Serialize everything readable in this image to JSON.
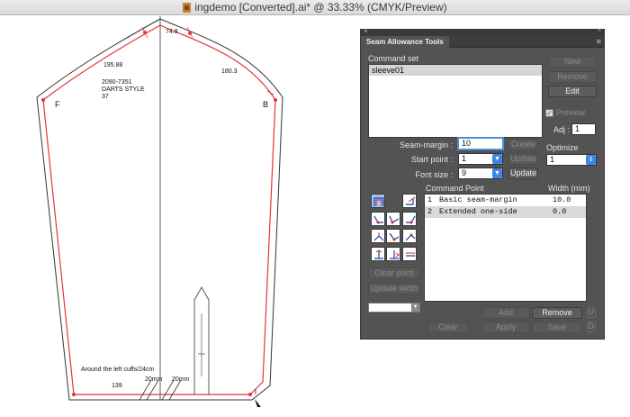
{
  "window": {
    "title": "ingdemo [Converted].ai* @ 33.33% (CMYK/Preview)"
  },
  "pattern": {
    "labels": {
      "cap_top": "74.8",
      "cap_left": "195.88",
      "cap_right": "180.3",
      "style_info": "2090-7351\nDARTS STYLE\n37",
      "side_f": "F",
      "side_b": "B",
      "cuff_note": "Around the left cuffs/24cm",
      "hem_left": "139",
      "hem_mid1": "20mm",
      "hem_mid2": "20mm"
    },
    "colors": {
      "seam_line": "#e8333a",
      "cut_line": "#333333"
    }
  },
  "panel": {
    "tab_title": "Seam Allowance Tools",
    "close_glyph": "×",
    "collapse_glyph": "«",
    "menu_glyph": "≡",
    "command_set": {
      "label": "Command set",
      "items": [
        "sleeve01"
      ],
      "new_label": "New",
      "remove_label": "Remove",
      "edit_label": "Edit"
    },
    "preview": {
      "label": "Preview",
      "checked": true
    },
    "adj": {
      "label": "Adj :",
      "value": "1"
    },
    "seam_margin": {
      "label": "Seam-margin :",
      "value": "10",
      "create_label": "Create"
    },
    "start_point": {
      "label": "Start point :",
      "value": "1",
      "update_label": "Update"
    },
    "font_size": {
      "label": "Font size :",
      "value": "9",
      "update_label": "Update"
    },
    "optimize": {
      "label": "Optimize",
      "value": "1"
    },
    "command_point": {
      "header_name": "Command Point",
      "header_width": "Width (mm)",
      "rows": [
        {
          "idx": "1",
          "name": "Basic seam-margin",
          "width": "10.0"
        },
        {
          "idx": "2",
          "name": "Extended one-side",
          "width": "0.0"
        }
      ]
    },
    "clear_point_label": "Clear point",
    "update_width_label": "Update width",
    "add_label": "Add",
    "remove_label": "Remove",
    "up_key": "U",
    "clear_label": "Clear",
    "apply_label": "Apply",
    "save_label": "Save",
    "down_key": "D",
    "accent_color": "#3d86e6"
  }
}
